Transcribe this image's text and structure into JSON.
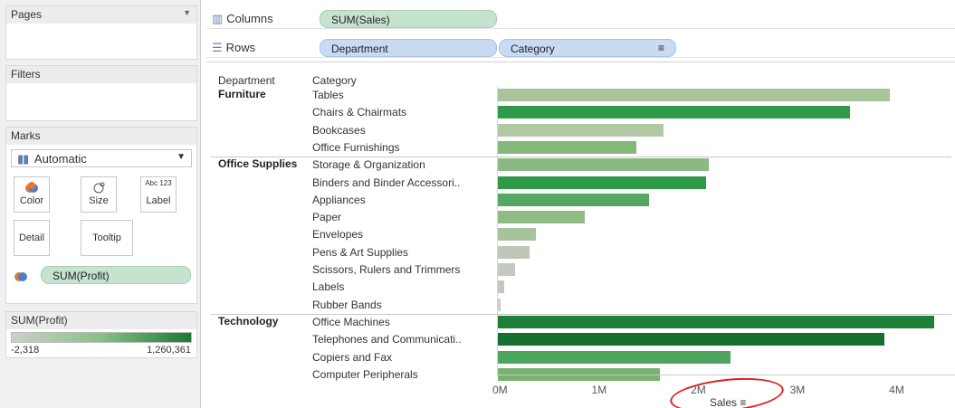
{
  "pages_card": {
    "title": "Pages"
  },
  "filters_card": {
    "title": "Filters"
  },
  "marks_card": {
    "title": "Marks",
    "mark_type": "Automatic",
    "buttons": [
      {
        "label": "Color",
        "icon": "color-icon"
      },
      {
        "label": "Size",
        "icon": "size-icon"
      },
      {
        "label": "Label",
        "icon": "label-icon",
        "icon_text": "Abc 123"
      },
      {
        "label": "Detail",
        "icon": "detail-icon"
      },
      {
        "label": "Tooltip",
        "icon": "tooltip-icon"
      }
    ],
    "color_pill": "SUM(Profit)"
  },
  "legend": {
    "title": "SUM(Profit)",
    "min": "-2,318",
    "max": "1,260,361"
  },
  "shelves": {
    "columns": {
      "label": "Columns",
      "pills": [
        "SUM(Sales)"
      ]
    },
    "rows": {
      "label": "Rows",
      "pills": [
        "Department",
        "Category"
      ]
    }
  },
  "chart_data": {
    "type": "bar",
    "orientation": "horizontal",
    "row_headers": [
      "Department",
      "Category"
    ],
    "xlabel": "Sales",
    "xticks": [
      "0M",
      "1M",
      "2M",
      "3M",
      "4M"
    ],
    "xlim": [
      0,
      4400000
    ],
    "groups": [
      {
        "department": "Furniture",
        "rows": [
          {
            "category": "Tables",
            "value": 3950000,
            "color": "#a9c49a"
          },
          {
            "category": "Chairs & Chairmats",
            "value": 3550000,
            "color": "#2f9a4a"
          },
          {
            "category": "Bookcases",
            "value": 1670000,
            "color": "#b2c8a5"
          },
          {
            "category": "Office Furnishings",
            "value": 1400000,
            "color": "#84b878"
          }
        ]
      },
      {
        "department": "Office Supplies",
        "rows": [
          {
            "category": "Storage & Organization",
            "value": 2130000,
            "color": "#8bb982"
          },
          {
            "category": "Binders and Binder Accessori..",
            "value": 2100000,
            "color": "#2e9a48"
          },
          {
            "category": "Appliances",
            "value": 1520000,
            "color": "#55a863"
          },
          {
            "category": "Paper",
            "value": 880000,
            "color": "#8fbb85"
          },
          {
            "category": "Envelopes",
            "value": 380000,
            "color": "#a7c39b"
          },
          {
            "category": "Pens & Art Supplies",
            "value": 320000,
            "color": "#bcc7b6"
          },
          {
            "category": "Scissors, Rulers and Trimmers",
            "value": 170000,
            "color": "#c6c8c2"
          },
          {
            "category": "Labels",
            "value": 60000,
            "color": "#c3c7bf"
          },
          {
            "category": "Rubber Bands",
            "value": 30000,
            "color": "#cbcdc8"
          }
        ]
      },
      {
        "department": "Technology",
        "rows": [
          {
            "category": "Office Machines",
            "value": 4400000,
            "color": "#1f7f38"
          },
          {
            "category": "Telephones and Communicati..",
            "value": 3900000,
            "color": "#17702f"
          },
          {
            "category": "Copiers and Fax",
            "value": 2350000,
            "color": "#4ea55f"
          },
          {
            "category": "Computer Peripherals",
            "value": 1630000,
            "color": "#78b36e"
          }
        ]
      }
    ]
  }
}
